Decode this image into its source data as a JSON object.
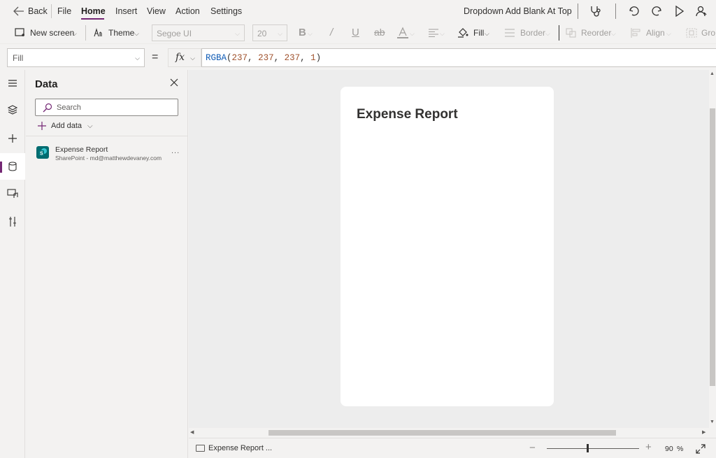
{
  "menu": {
    "back_label": "Back",
    "items": [
      {
        "label": "File"
      },
      {
        "label": "Home"
      },
      {
        "label": "Insert"
      },
      {
        "label": "View"
      },
      {
        "label": "Action"
      },
      {
        "label": "Settings"
      }
    ],
    "active_tab": "Home",
    "app_title": "Dropdown Add Blank At Top"
  },
  "toolbar": {
    "new_screen_label": "New screen",
    "theme_label": "Theme",
    "font_family_value": "Segoe UI",
    "font_size_value": "20",
    "fill_label": "Fill",
    "border_label": "Border",
    "reorder_label": "Reorder",
    "align_label": "Align",
    "group_label": "Gro"
  },
  "formula_bar": {
    "property_value": "Fill",
    "equals": "=",
    "fx_label": "fx",
    "formula_fn": "RGBA",
    "formula_args": [
      "237",
      "237",
      "237",
      "1"
    ]
  },
  "data_panel": {
    "title": "Data",
    "search_placeholder": "Search",
    "add_data_label": "Add data",
    "data_source": {
      "name": "Expense Report",
      "subtitle": "SharePoint - md@matthewdevaney.com",
      "more": "..."
    }
  },
  "canvas": {
    "screen_title": "Expense Report"
  },
  "status_bar": {
    "screen_label": "Expense Report ...",
    "zoom_value": "90",
    "zoom_unit": "%"
  },
  "colors": {
    "accent": "#742774",
    "sharepoint": "#036c70",
    "canvas_bg": "#ededed"
  }
}
